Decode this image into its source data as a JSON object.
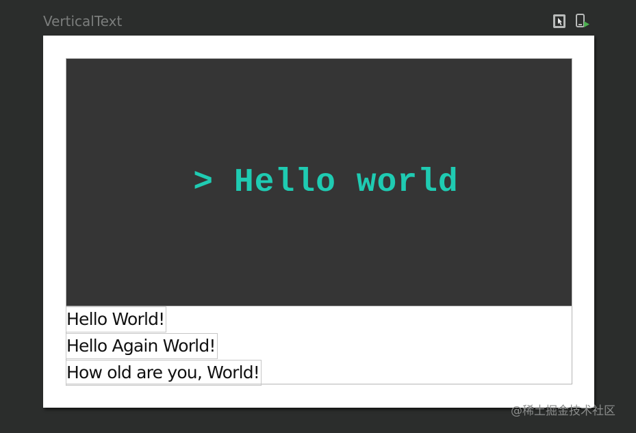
{
  "preview": {
    "title": "VerticalText"
  },
  "toolbar": {
    "interactive_icon": "interactive-mode-icon",
    "deploy_icon": "deploy-to-device-icon",
    "accent_color": "#4caf50"
  },
  "terminal": {
    "text": "> Hello world",
    "background": "#353535",
    "text_color": "#1fcbb2"
  },
  "texts": [
    "Hello World!",
    "Hello Again World!",
    "How old are you, World!"
  ],
  "watermark": "@稀土掘金技术社区"
}
